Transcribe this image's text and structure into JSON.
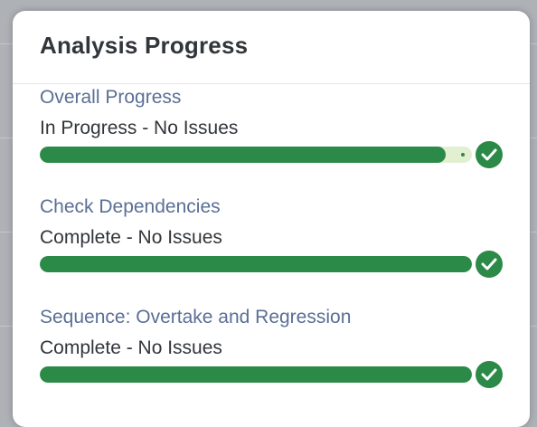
{
  "popover": {
    "title": "Analysis Progress"
  },
  "steps": [
    {
      "title": "Overall Progress",
      "status": "In Progress - No Issues",
      "progress": 0.94
    },
    {
      "title": "Check Dependencies",
      "status": "Complete - No Issues",
      "progress": 1.0
    },
    {
      "title": "Sequence: Overtake and Regression",
      "status": "Complete - No Issues",
      "progress": 1.0
    }
  ],
  "colors": {
    "accent_green": "#2b8a47",
    "track_light_green": "#e2f0d1",
    "step_title_blue": "#5a6f95",
    "text_dark": "#32363a"
  },
  "icons": {
    "status": "check-circle-icon"
  }
}
